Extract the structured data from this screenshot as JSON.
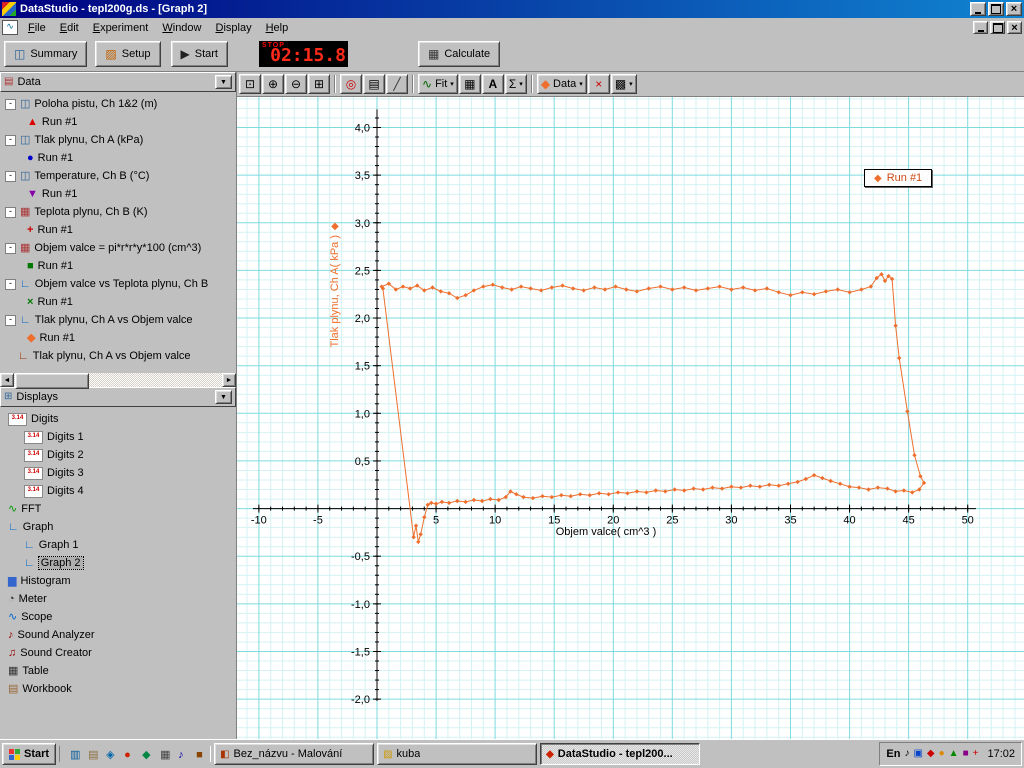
{
  "titlebar": {
    "title": "DataStudio - tepl200g.ds - [Graph 2]"
  },
  "menubar": {
    "items": [
      "File",
      "Edit",
      "Experiment",
      "Window",
      "Display",
      "Help"
    ]
  },
  "toolbar": {
    "summary": "Summary",
    "setup": "Setup",
    "start": "Start",
    "stop_label": "STOP",
    "timer": "02:15.8",
    "calculate": "Calculate"
  },
  "graph_toolbar": {
    "buttons": [
      {
        "name": "scale-to-fit",
        "glyph": "⊡"
      },
      {
        "name": "zoom-in",
        "glyph": "⊕"
      },
      {
        "name": "zoom-out",
        "glyph": "⊖"
      },
      {
        "name": "zoom-select",
        "glyph": "⊞"
      },
      {
        "type": "sep"
      },
      {
        "name": "smart-tool",
        "glyph": "◎",
        "color": "#cc0000"
      },
      {
        "name": "note-tool",
        "glyph": "▤"
      },
      {
        "name": "slope-tool",
        "glyph": "╱",
        "color": "#333333"
      },
      {
        "type": "sep"
      },
      {
        "name": "fit-menu",
        "glyph": "∿",
        "color": "#006600",
        "label": "Fit",
        "dropdown": true
      },
      {
        "name": "calculate-tool",
        "glyph": "▦"
      },
      {
        "name": "text-tool",
        "glyph": "A"
      },
      {
        "name": "statistics-menu",
        "glyph": "Σ",
        "dropdown": true
      },
      {
        "type": "sep"
      },
      {
        "name": "data-menu",
        "glyph": "◆",
        "color": "#ee6f2d",
        "label": "Data",
        "dropdown": true
      },
      {
        "name": "remove-item",
        "glyph": "×",
        "color": "#cc0000"
      },
      {
        "name": "graph-settings",
        "glyph": "▩",
        "dropdown": true
      }
    ]
  },
  "sidebar": {
    "data_panel": {
      "title": "Data",
      "items": [
        {
          "label": "Poloha pistu, Ch 1&2 (m)",
          "icon": {
            "glyph": "◫",
            "color": "#336699"
          },
          "runs": [
            {
              "label": "Run #1",
              "marker": "▲",
              "color": "#dd0000"
            }
          ]
        },
        {
          "label": "Tlak plynu, Ch A (kPa)",
          "icon": {
            "glyph": "◫",
            "color": "#336699"
          },
          "runs": [
            {
              "label": "Run #1",
              "marker": "●",
              "color": "#0000cc"
            }
          ]
        },
        {
          "label": "Temperature, Ch B (°C)",
          "icon": {
            "glyph": "◫",
            "color": "#336699"
          },
          "runs": [
            {
              "label": "Run #1",
              "marker": "▼",
              "color": "#8800aa"
            }
          ]
        },
        {
          "label": "Teplota plynu, Ch B (K)",
          "icon": {
            "glyph": "▦",
            "color": "#aa3333"
          },
          "runs": [
            {
              "label": "Run #1",
              "marker": "+",
              "color": "#cc0000"
            }
          ]
        },
        {
          "label": "Objem valce = pi*r*r*y*100 (cm^3)",
          "icon": {
            "glyph": "▦",
            "color": "#aa3333"
          },
          "runs": [
            {
              "label": "Run #1",
              "marker": "■",
              "color": "#007700"
            }
          ]
        },
        {
          "label": "Objem valce vs Teplota plynu, Ch B",
          "icon": {
            "glyph": "∟",
            "color": "#0066cc"
          },
          "runs": [
            {
              "label": "Run #1",
              "marker": "×",
              "color": "#007700"
            }
          ]
        },
        {
          "label": "Tlak plynu, Ch A vs Objem valce",
          "icon": {
            "glyph": "∟",
            "color": "#0066cc"
          },
          "runs": [
            {
              "label": "Run #1",
              "marker": "◆",
              "color": "#ee6f2d"
            }
          ]
        },
        {
          "label": "Tlak plynu, Ch A vs Objem valce",
          "icon": {
            "glyph": "∟",
            "color": "#993300"
          },
          "runs": []
        }
      ]
    },
    "displays_panel": {
      "title": "Displays",
      "items": [
        {
          "label": "Digits",
          "icon": "3.14",
          "indent": 0
        },
        {
          "label": "Digits 1",
          "icon": "3.14",
          "indent": 1
        },
        {
          "label": "Digits 2",
          "icon": "3.14",
          "indent": 1
        },
        {
          "label": "Digits 3",
          "icon": "3.14",
          "indent": 1
        },
        {
          "label": "Digits 4",
          "icon": "3.14",
          "indent": 1
        },
        {
          "label": "FFT",
          "icon": "∿",
          "color": "#009900",
          "indent": 0
        },
        {
          "label": "Graph",
          "icon": "∟",
          "color": "#0066cc",
          "indent": 0
        },
        {
          "label": "Graph 1",
          "icon": "∟",
          "color": "#0066cc",
          "indent": 1
        },
        {
          "label": "Graph 2",
          "icon": "∟",
          "color": "#0066cc",
          "indent": 1,
          "selected": true
        },
        {
          "label": "Histogram",
          "icon": "▆",
          "color": "#3366cc",
          "indent": 0
        },
        {
          "label": "Meter",
          "icon": "◔",
          "color": "#333333",
          "indent": 0
        },
        {
          "label": "Scope",
          "icon": "∿",
          "color": "#0066cc",
          "indent": 0
        },
        {
          "label": "Sound Analyzer",
          "icon": "♪",
          "color": "#990000",
          "indent": 0
        },
        {
          "label": "Sound Creator",
          "icon": "♫",
          "color": "#990000",
          "indent": 0
        },
        {
          "label": "Table",
          "icon": "▦",
          "color": "#333333",
          "indent": 0
        },
        {
          "label": "Workbook",
          "icon": "▤",
          "color": "#996633",
          "indent": 0
        }
      ]
    }
  },
  "chart_data": {
    "type": "scatter",
    "title": "",
    "xlabel": "Objem valce( cm^3 )",
    "ylabel": "Tlak plynu, Ch A( kPa )",
    "xlim": [
      -11.85,
      54.85
    ],
    "ylim": [
      -2.45,
      4.32
    ],
    "xticks": [
      -10,
      -5,
      5,
      10,
      15,
      20,
      25,
      30,
      35,
      40,
      45,
      50
    ],
    "xtick_labels": [
      "-10",
      "-5",
      "5",
      "10",
      "15",
      "20",
      "25",
      "30",
      "35",
      "40",
      "45",
      "50"
    ],
    "yticks": [
      4.0,
      3.5,
      3.0,
      2.5,
      2.0,
      1.5,
      1.0,
      0.5,
      -0.5,
      -1.0,
      -1.5,
      -2.0
    ],
    "ytick_labels": [
      "4,0",
      "3,5",
      "3,0",
      "2,5",
      "2,0",
      "1,5",
      "1,0",
      "0,5",
      "-0,5",
      "-1,0",
      "-1,5",
      "-2,0"
    ],
    "grid": {
      "minor_x": 1,
      "minor_y": 0.1,
      "major_x": 5,
      "major_y": 0.5
    },
    "colors": {
      "grid_minor": "#d4f2f3",
      "grid_major": "#7edbe0",
      "axis": "#000000"
    },
    "legend": {
      "label": "Run #1",
      "position": "top-right"
    },
    "series": [
      {
        "name": "Run #1",
        "color": "#ee6f2d",
        "marker": "diamond",
        "points": [
          [
            0.4,
            2.33
          ],
          [
            1.0,
            2.36
          ],
          [
            1.6,
            2.3
          ],
          [
            2.2,
            2.33
          ],
          [
            2.8,
            2.31
          ],
          [
            3.4,
            2.34
          ],
          [
            4.0,
            2.29
          ],
          [
            4.7,
            2.32
          ],
          [
            5.4,
            2.28
          ],
          [
            6.1,
            2.26
          ],
          [
            6.8,
            2.21
          ],
          [
            7.5,
            2.24
          ],
          [
            8.2,
            2.29
          ],
          [
            9.0,
            2.33
          ],
          [
            9.8,
            2.35
          ],
          [
            10.6,
            2.32
          ],
          [
            11.4,
            2.3
          ],
          [
            12.2,
            2.33
          ],
          [
            13.0,
            2.31
          ],
          [
            13.9,
            2.29
          ],
          [
            14.8,
            2.32
          ],
          [
            15.7,
            2.34
          ],
          [
            16.6,
            2.31
          ],
          [
            17.5,
            2.29
          ],
          [
            18.4,
            2.32
          ],
          [
            19.3,
            2.3
          ],
          [
            20.2,
            2.33
          ],
          [
            21.1,
            2.3
          ],
          [
            22.0,
            2.28
          ],
          [
            23.0,
            2.31
          ],
          [
            24.0,
            2.33
          ],
          [
            25.0,
            2.3
          ],
          [
            26.0,
            2.32
          ],
          [
            27.0,
            2.29
          ],
          [
            28.0,
            2.31
          ],
          [
            29.0,
            2.33
          ],
          [
            30.0,
            2.3
          ],
          [
            31.0,
            2.32
          ],
          [
            32.0,
            2.29
          ],
          [
            33.0,
            2.31
          ],
          [
            34.0,
            2.27
          ],
          [
            35.0,
            2.24
          ],
          [
            36.0,
            2.27
          ],
          [
            37.0,
            2.25
          ],
          [
            38.0,
            2.28
          ],
          [
            39.0,
            2.3
          ],
          [
            40.0,
            2.27
          ],
          [
            41.0,
            2.3
          ],
          [
            41.8,
            2.33
          ],
          [
            42.3,
            2.42
          ],
          [
            42.7,
            2.46
          ],
          [
            43.0,
            2.39
          ],
          [
            43.3,
            2.44
          ],
          [
            43.6,
            2.41
          ],
          [
            43.9,
            1.92
          ],
          [
            44.2,
            1.58
          ],
          [
            44.9,
            1.02
          ],
          [
            45.5,
            0.56
          ],
          [
            46.0,
            0.34
          ],
          [
            46.3,
            0.27
          ],
          [
            45.9,
            0.2
          ],
          [
            45.3,
            0.17
          ],
          [
            44.6,
            0.19
          ],
          [
            43.9,
            0.18
          ],
          [
            43.2,
            0.21
          ],
          [
            42.4,
            0.22
          ],
          [
            41.6,
            0.2
          ],
          [
            40.8,
            0.22
          ],
          [
            40.0,
            0.23
          ],
          [
            39.2,
            0.26
          ],
          [
            38.4,
            0.29
          ],
          [
            37.7,
            0.32
          ],
          [
            37.0,
            0.35
          ],
          [
            36.3,
            0.31
          ],
          [
            35.6,
            0.28
          ],
          [
            34.8,
            0.26
          ],
          [
            34.0,
            0.24
          ],
          [
            33.2,
            0.25
          ],
          [
            32.4,
            0.23
          ],
          [
            31.6,
            0.24
          ],
          [
            30.8,
            0.22
          ],
          [
            30.0,
            0.23
          ],
          [
            29.2,
            0.21
          ],
          [
            28.4,
            0.22
          ],
          [
            27.6,
            0.2
          ],
          [
            26.8,
            0.21
          ],
          [
            26.0,
            0.19
          ],
          [
            25.2,
            0.2
          ],
          [
            24.4,
            0.18
          ],
          [
            23.6,
            0.19
          ],
          [
            22.8,
            0.17
          ],
          [
            22.0,
            0.18
          ],
          [
            21.2,
            0.16
          ],
          [
            20.4,
            0.17
          ],
          [
            19.6,
            0.15
          ],
          [
            18.8,
            0.16
          ],
          [
            18.0,
            0.14
          ],
          [
            17.2,
            0.15
          ],
          [
            16.4,
            0.13
          ],
          [
            15.6,
            0.14
          ],
          [
            14.8,
            0.12
          ],
          [
            14.0,
            0.13
          ],
          [
            13.2,
            0.11
          ],
          [
            12.4,
            0.12
          ],
          [
            11.8,
            0.15
          ],
          [
            11.3,
            0.18
          ],
          [
            10.9,
            0.12
          ],
          [
            10.3,
            0.09
          ],
          [
            9.6,
            0.1
          ],
          [
            8.9,
            0.08
          ],
          [
            8.2,
            0.09
          ],
          [
            7.5,
            0.07
          ],
          [
            6.8,
            0.08
          ],
          [
            6.1,
            0.06
          ],
          [
            5.5,
            0.07
          ],
          [
            5.0,
            0.05
          ],
          [
            4.6,
            0.06
          ],
          [
            4.3,
            0.04
          ],
          [
            4.0,
            -0.09
          ],
          [
            3.7,
            -0.27
          ],
          [
            3.5,
            -0.35
          ],
          [
            3.3,
            -0.18
          ],
          [
            3.1,
            -0.3
          ],
          [
            0.5,
            2.31
          ]
        ]
      }
    ]
  },
  "taskbar": {
    "start_label": "Start",
    "quicklaunch": [
      {
        "glyph": "▥",
        "color": "#005a9e"
      },
      {
        "glyph": "▤",
        "color": "#8a6d3b"
      },
      {
        "glyph": "◈",
        "color": "#0066aa"
      },
      {
        "glyph": "●",
        "color": "#cc2200"
      },
      {
        "glyph": "◆",
        "color": "#008844"
      },
      {
        "glyph": "▦",
        "color": "#444444"
      },
      {
        "glyph": "♪",
        "color": "#0000aa"
      },
      {
        "glyph": "■",
        "color": "#884400"
      }
    ],
    "tasks": [
      {
        "label": "Bez_názvu - Malování",
        "icon": "◧",
        "icon_color": "#aa3300",
        "active": false
      },
      {
        "label": "kuba",
        "icon": "▨",
        "icon_color": "#cc9900",
        "active": false
      },
      {
        "label": "DataStudio - tepl200...",
        "icon": "◆",
        "icon_color": "#cc2200",
        "active": true
      }
    ],
    "tray": {
      "layout": "En",
      "time": "17:02",
      "icons": [
        {
          "glyph": "♪",
          "color": "#000000"
        },
        {
          "glyph": "▣",
          "color": "#0044cc"
        },
        {
          "glyph": "◆",
          "color": "#cc0000"
        },
        {
          "glyph": "●",
          "color": "#dd8800"
        },
        {
          "glyph": "▲",
          "color": "#008800"
        },
        {
          "glyph": "■",
          "color": "#880088"
        },
        {
          "glyph": "+",
          "color": "#cc0000"
        }
      ]
    }
  }
}
